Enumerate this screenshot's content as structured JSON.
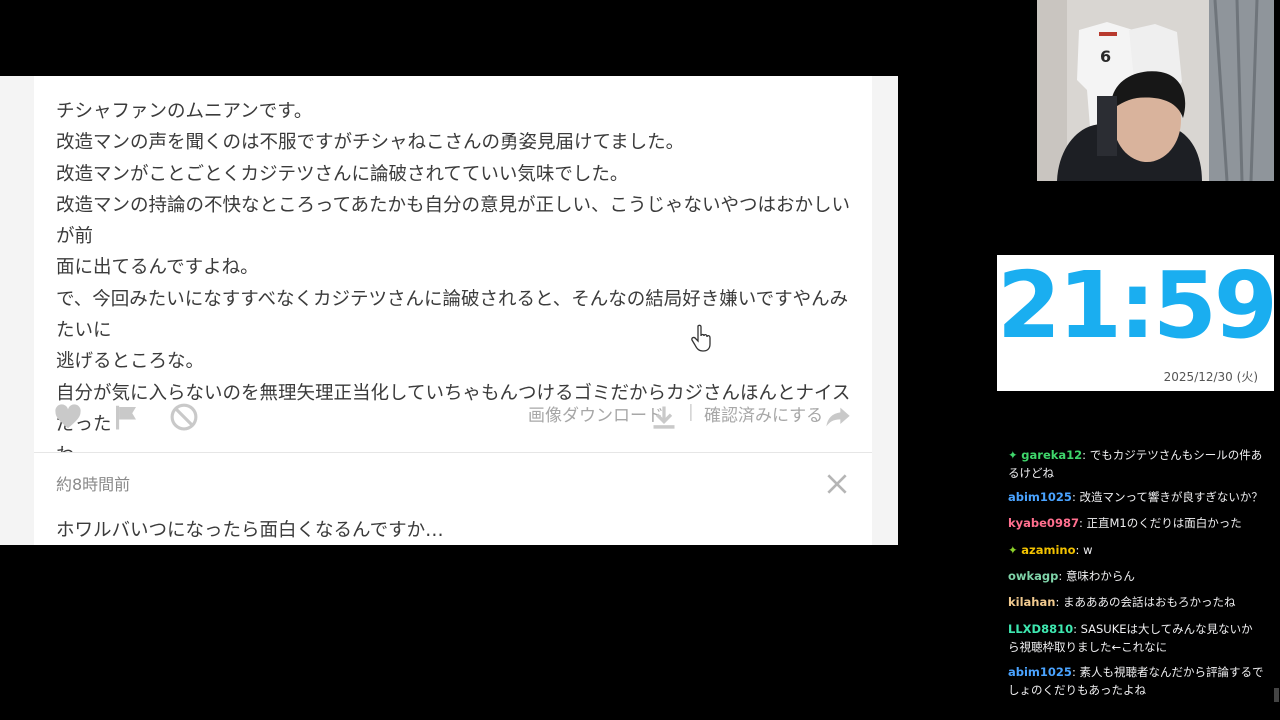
{
  "comment_card": {
    "lines": [
      "チシャファンのムニアンです。",
      "改造マンの声を聞くのは不服ですがチシャねこさんの勇姿見届けてました。",
      "改造マンがことごとくカジテツさんに論破されてていい気味でした。",
      "改造マンの持論の不快なところってあたかも自分の意見が正しい、こうじゃないやつはおかしいが前",
      "面に出てるんですよね。",
      "で、今回みたいになすすべなくカジテツさんに論破されると、そんなの結局好き嫌いですやんみたいに",
      "逃げるところな。",
      "自分が気に入らないのを無理矢理正当化していちゃもんつけるゴミだからカジさんほんとナイスだった",
      "わ。"
    ],
    "download_label": "画像ダウンロード",
    "separator": "|",
    "confirm_label": "確認済みにする"
  },
  "next_card": {
    "time_ago": "約8時間前",
    "message": "ホワルバいつになったら面白くなるんですか…"
  },
  "clock": {
    "time": "21:59",
    "date": "2025/12/30 (火)"
  },
  "chat": {
    "messages": [
      {
        "user": "gareka12",
        "text": "でもカジテツさんもシールの件あるけどね",
        "color": "#3fd66b"
      },
      {
        "user": "abim1025",
        "text": "改造マンって響きが良すぎないか？",
        "color": "#4aa3ff"
      },
      {
        "user": "kyabe0987",
        "text": "正直M1のくだりは面白かった",
        "color": "#ff6f8e"
      },
      {
        "user": "azamino",
        "text": "w",
        "color": "#f2c200"
      },
      {
        "user": "owkagp",
        "text": "意味わからん",
        "color": "#7fd3a8"
      },
      {
        "user": "kilahan",
        "text": "まあああの会話はおもろかったね",
        "color": "#f0c98e"
      },
      {
        "user": "LLXD8810",
        "text": "SASUKEは大してみんな見ないから視聴枠取りました←これなに",
        "color": "#3ee8b0"
      },
      {
        "user": "abim1025",
        "text": "素人も視聴者なんだから評論するでしょのくだりもあったよね",
        "color": "#4aa3ff"
      }
    ]
  },
  "colors": {
    "clock_digits": "#1aaef0",
    "icon_gray": "#c9c9c9"
  }
}
